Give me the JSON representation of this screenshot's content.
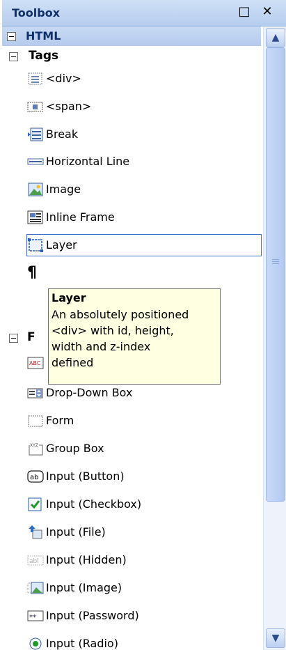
{
  "window": {
    "title": "Toolbox",
    "restore_glyph": "□",
    "close_glyph": "✕"
  },
  "group": {
    "title": "HTML"
  },
  "tags_category": {
    "title": "Tags"
  },
  "tags_items": [
    {
      "label": "<div>",
      "icon": "div-icon"
    },
    {
      "label": "<span>",
      "icon": "span-icon"
    },
    {
      "label": "Break",
      "icon": "break-icon"
    },
    {
      "label": "Horizontal Line",
      "icon": "horizontal-line-icon"
    },
    {
      "label": "Image",
      "icon": "image-icon"
    },
    {
      "label": "Inline Frame",
      "icon": "inline-frame-icon"
    },
    {
      "label": "Layer",
      "icon": "layer-icon",
      "selected": true
    }
  ],
  "paragraph_glyph": "¶",
  "forms_category": {
    "title_visible": "F"
  },
  "forms_items": [
    {
      "label": "Drop-Down Box",
      "icon": "dropdown-icon"
    },
    {
      "label": "Form",
      "icon": "form-icon"
    },
    {
      "label": "Group Box",
      "icon": "group-box-icon"
    },
    {
      "label": "Input (Button)",
      "icon": "input-button-icon"
    },
    {
      "label": "Input (Checkbox)",
      "icon": "checkbox-icon"
    },
    {
      "label": "Input (File)",
      "icon": "input-file-icon"
    },
    {
      "label": "Input (Hidden)",
      "icon": "input-hidden-icon"
    },
    {
      "label": "Input (Image)",
      "icon": "input-image-icon"
    },
    {
      "label": "Input (Password)",
      "icon": "input-password-icon"
    },
    {
      "label": "Input (Radio)",
      "icon": "radio-icon"
    }
  ],
  "tooltip": {
    "title": "Layer",
    "lines": [
      "An absolutely positioned",
      "<div> with id, height,",
      "width and z-index",
      "defined"
    ]
  },
  "colors": {
    "accent": "#3d6fc6",
    "header": "#b6cdee",
    "tooltip_bg": "#ffffe1"
  }
}
